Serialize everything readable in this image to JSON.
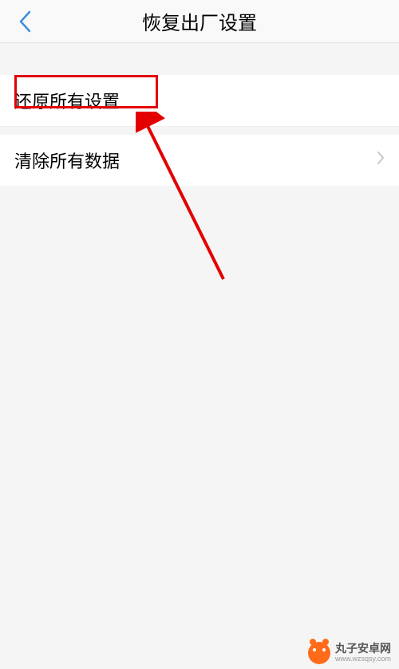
{
  "header": {
    "title": "恢复出厂设置"
  },
  "items": [
    {
      "label": "还原所有设置",
      "chevron": false
    },
    {
      "label": "清除所有数据",
      "chevron": true
    }
  ],
  "watermark": {
    "name": "丸子安卓网",
    "url": "www.wzsqsy.com"
  }
}
